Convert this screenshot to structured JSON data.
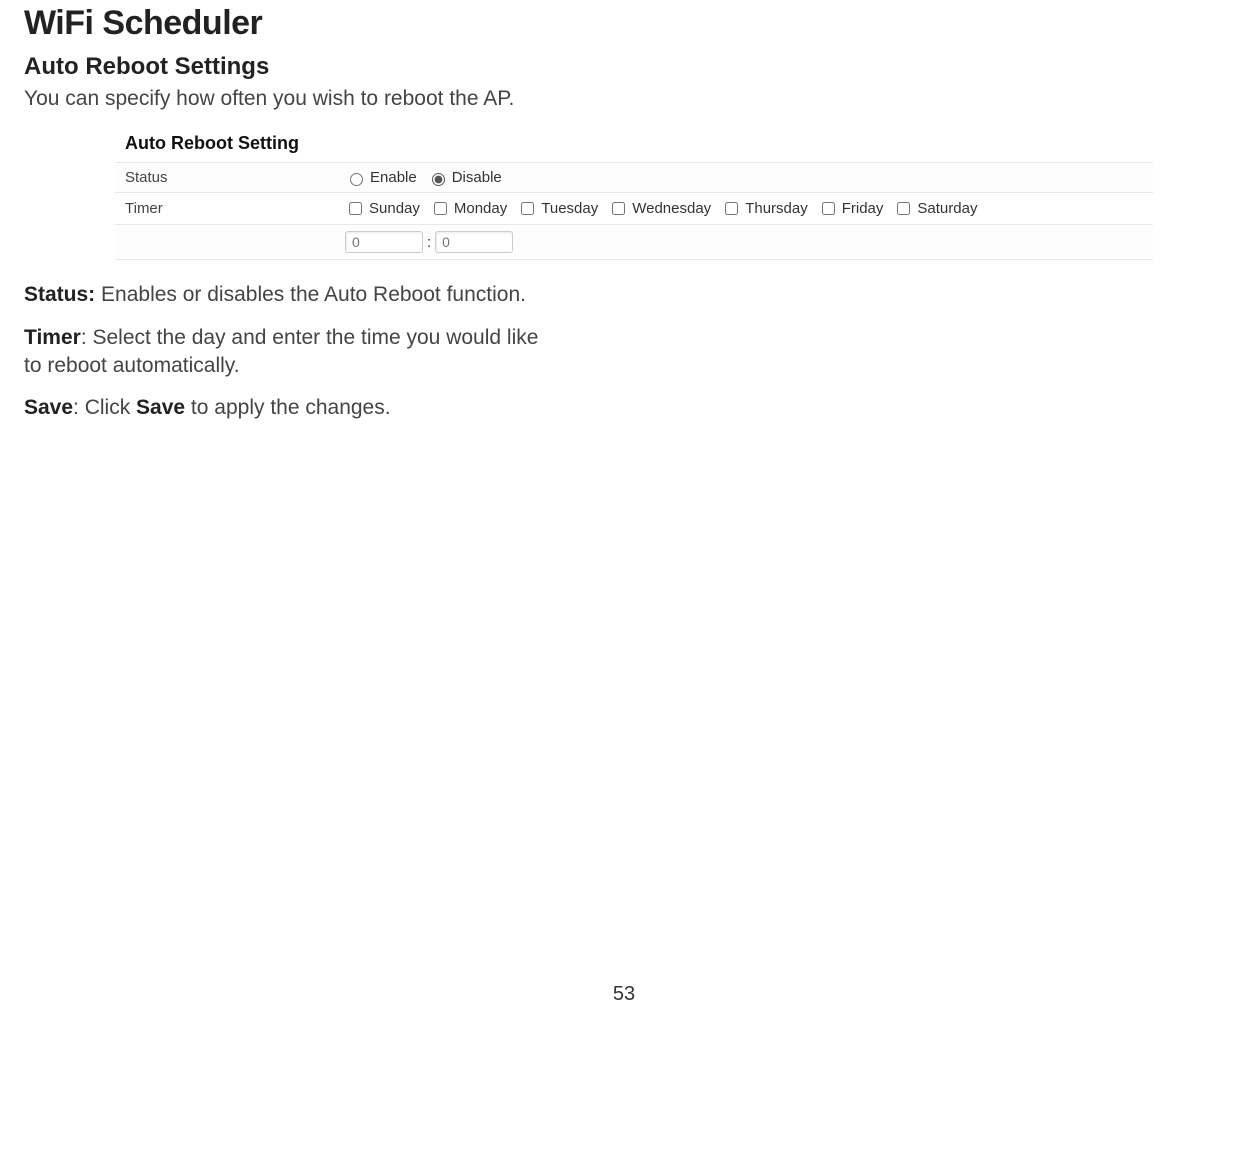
{
  "page_number": "53",
  "title": "WiFi Scheduler",
  "subtitle": "Auto Reboot Settings",
  "intro": "You can specify how often you wish to reboot the AP.",
  "box": {
    "heading": "Auto Reboot Setting",
    "rows": {
      "status": {
        "label": "Status",
        "enable_label": "Enable",
        "disable_label": "Disable",
        "selected": "Disable"
      },
      "timer": {
        "label": "Timer",
        "days": [
          "Sunday",
          "Monday",
          "Tuesday",
          "Wednesday",
          "Thursday",
          "Friday",
          "Saturday"
        ],
        "hour_placeholder": "0",
        "minute_placeholder": "0"
      }
    }
  },
  "definitions": {
    "status": {
      "term": "Status:",
      "desc": " Enables or disables the Auto Reboot function."
    },
    "timer": {
      "term": "Timer",
      "desc_line1": ": Select the day and enter the time you would like",
      "desc_line2": "to reboot automatically."
    },
    "save": {
      "term": "Save",
      "mid": ": Click ",
      "term2": "Save",
      "desc": " to apply the changes."
    }
  }
}
